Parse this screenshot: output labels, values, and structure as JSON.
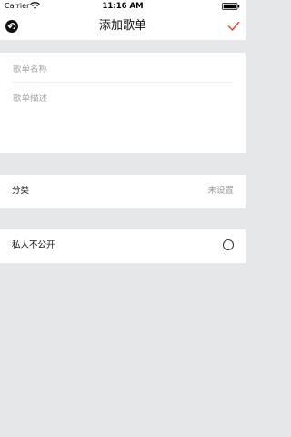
{
  "status_bar": {
    "carrier": "Carrier",
    "time": "11:16 AM",
    "wifi_icon": "wifi-icon",
    "battery_icon": "battery-icon"
  },
  "nav": {
    "title": "添加歌单",
    "back_icon": "back-arrow-icon",
    "confirm_icon": "checkmark-icon",
    "accent_color": "#e8473a"
  },
  "form": {
    "name_placeholder": "歌单名称",
    "name_value": "",
    "description_placeholder": "歌单描述",
    "description_value": ""
  },
  "category": {
    "label": "分类",
    "value": "未设置"
  },
  "privacy": {
    "label": "私人不公开",
    "checked": false
  }
}
